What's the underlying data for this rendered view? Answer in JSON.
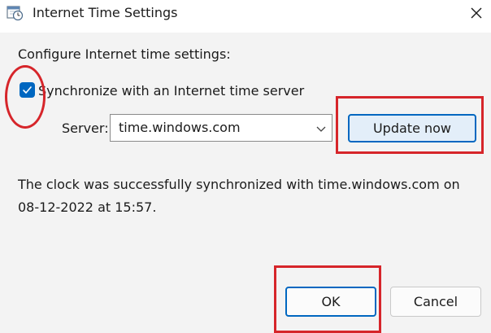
{
  "window": {
    "title": "Internet Time Settings",
    "app_icon": "clock-calendar-icon",
    "close_icon": "close-icon"
  },
  "settings": {
    "heading": "Configure Internet time settings:",
    "sync_checkbox": {
      "label": "Synchronize with an Internet time server",
      "checked": true
    },
    "server_label": "Server:",
    "server_value": "time.windows.com",
    "update_button": "Update now",
    "status_line_1": "The clock was successfully synchronized with time.windows.com on",
    "status_line_2": "08-12-2022 at 15:57."
  },
  "footer": {
    "ok_label": "OK",
    "cancel_label": "Cancel"
  },
  "colors": {
    "accent": "#0067c0",
    "annotation": "#d6252a"
  }
}
